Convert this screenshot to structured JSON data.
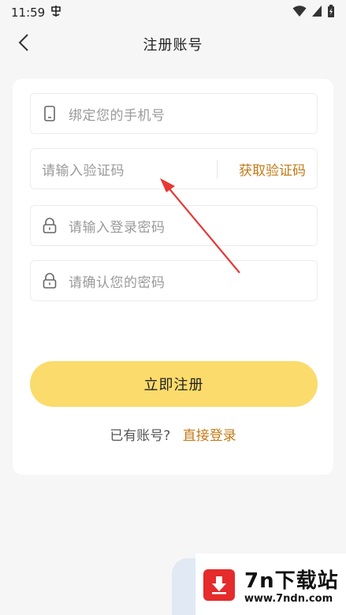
{
  "status_bar": {
    "time": "11:59",
    "notification_icon": "app-notification-icon",
    "icons": [
      "wifi-icon",
      "signal-icon",
      "battery-icon"
    ]
  },
  "header": {
    "title": "注册账号",
    "back_icon": "chevron-left-icon"
  },
  "form": {
    "phone_placeholder": "绑定您的手机号",
    "code_placeholder": "请输入验证码",
    "get_code_label": "获取验证码",
    "password_placeholder": "请输入登录密码",
    "confirm_placeholder": "请确认您的密码",
    "submit_label": "立即注册"
  },
  "footer": {
    "have_account": "已有账号?",
    "login_link": "直接登录"
  },
  "watermark": {
    "brand": "7n下载站",
    "url": "www.7ndn.com"
  },
  "colors": {
    "accent": "#c47a17",
    "button": "#fadb6c",
    "annotation_arrow": "#e53935"
  }
}
